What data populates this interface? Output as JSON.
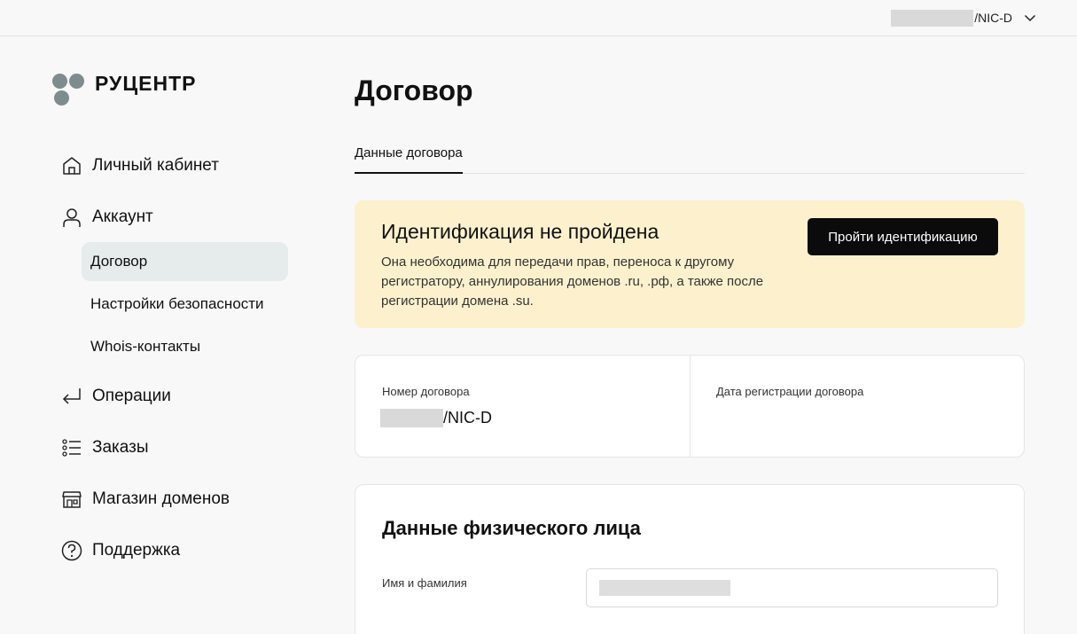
{
  "header": {
    "account_suffix": "/NIC-D",
    "chevron_icon": "chevron-down-icon"
  },
  "brand": {
    "logo_text": "РУЦЕНТР",
    "dot_color": "#7d8c8e"
  },
  "sidebar": {
    "items": [
      {
        "label": "Личный кабинет",
        "icon": "home-icon"
      },
      {
        "label": "Аккаунт",
        "icon": "user-icon"
      },
      {
        "label": "Операции",
        "icon": "return-arrow-icon"
      },
      {
        "label": "Заказы",
        "icon": "list-icon"
      },
      {
        "label": "Магазин доменов",
        "icon": "store-icon"
      },
      {
        "label": "Поддержка",
        "icon": "help-circle-icon"
      }
    ],
    "subitems": [
      {
        "label": "Договор",
        "active": true
      },
      {
        "label": "Настройки безопасности",
        "active": false
      },
      {
        "label": "Whois-контакты",
        "active": false
      }
    ]
  },
  "main": {
    "title": "Договор",
    "tabs": [
      {
        "label": "Данные договора",
        "active": true
      }
    ],
    "alert": {
      "title": "Идентификация не пройдена",
      "text": "Она необходима для передачи прав, переноса к другому регистратору, аннулирования доменов .ru, .рф, а также после регистрации домена .su.",
      "button_label": "Пройти идентификацию",
      "background": "#fdf1cd"
    },
    "contract": {
      "number_label": "Номер договора",
      "number_suffix": "/NIC-D",
      "date_label": "Дата регистрации договора"
    },
    "person": {
      "title": "Данные физического лица",
      "name_label": "Имя и фамилия"
    }
  }
}
